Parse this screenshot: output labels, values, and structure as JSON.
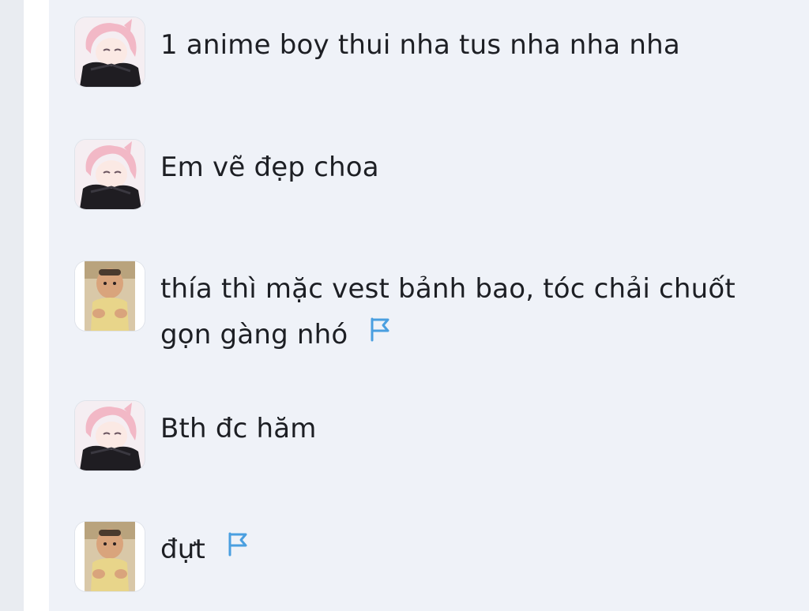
{
  "comments": [
    {
      "avatar": "anime-girl-avatar",
      "text": "1 anime boy thui nha tus nha nha nha",
      "flag": false
    },
    {
      "avatar": "anime-girl-avatar",
      "text": "Em vẽ đẹp choa",
      "flag": false
    },
    {
      "avatar": "baby-photo-avatar",
      "text": "thía thì mặc vest bảnh bao, tóc chải chuốt gọn gàng nhó",
      "flag": true
    },
    {
      "avatar": "anime-girl-avatar",
      "text": "Bth đc hăm",
      "flag": false
    },
    {
      "avatar": "baby-photo-avatar",
      "text": "đựt",
      "flag": true
    }
  ],
  "colors": {
    "feed_background": "#eff2f8",
    "text": "#1d1f24",
    "flag": "#4a9fe0"
  },
  "icons": {
    "report": "flag-icon"
  }
}
